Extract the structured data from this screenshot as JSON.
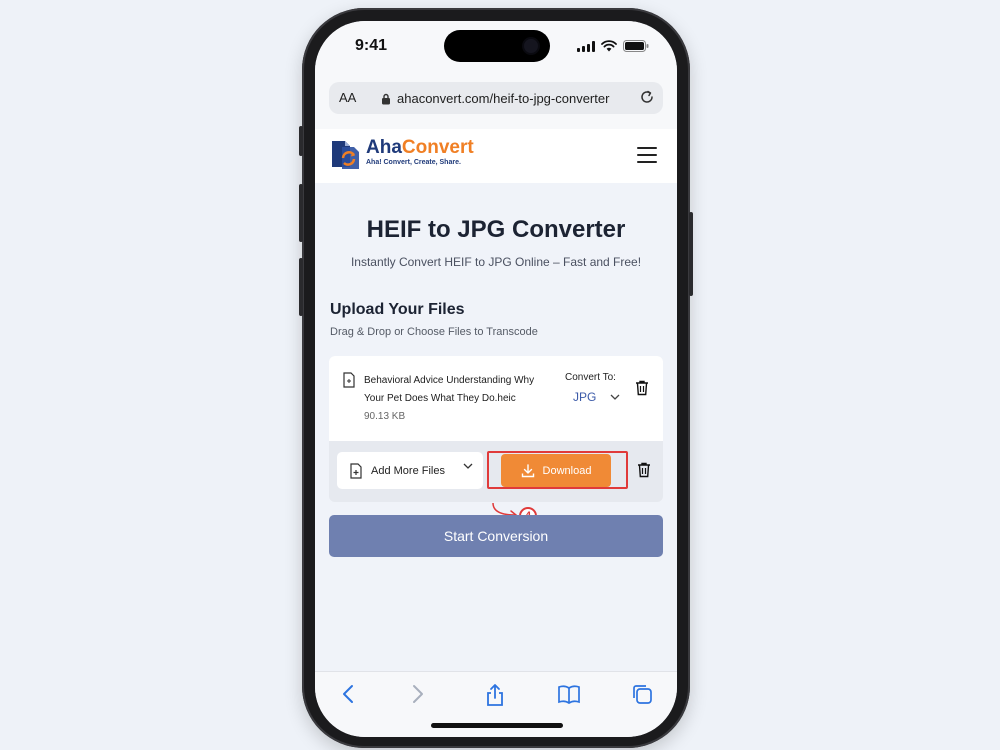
{
  "status": {
    "time": "9:41"
  },
  "browser": {
    "text_size_label": "AA",
    "url": "ahaconvert.com/heif-to-jpg-converter"
  },
  "site": {
    "brand_part1": "Aha",
    "brand_part2": "Convert",
    "tagline": "Aha! Convert, Create, Share."
  },
  "main": {
    "title": "HEIF to JPG Converter",
    "subtitle": "Instantly Convert HEIF to JPG Online – Fast and Free!",
    "upload_heading": "Upload Your Files",
    "upload_sub": "Drag & Drop or Choose Files to Transcode"
  },
  "file": {
    "name": "Behavioral Advice Understanding Why Your Pet Does What They Do.heic",
    "size": "90.13 KB",
    "convert_label": "Convert To:",
    "format": "JPG"
  },
  "actions": {
    "add_more": "Add More Files",
    "download": "Download",
    "step_number": "4",
    "start_conversion": "Start Conversion"
  },
  "colors": {
    "accent_orange": "#f08a36",
    "brand_blue": "#1f3a7a",
    "start_button": "#6f80b0",
    "highlight_red": "#e03a3a"
  }
}
